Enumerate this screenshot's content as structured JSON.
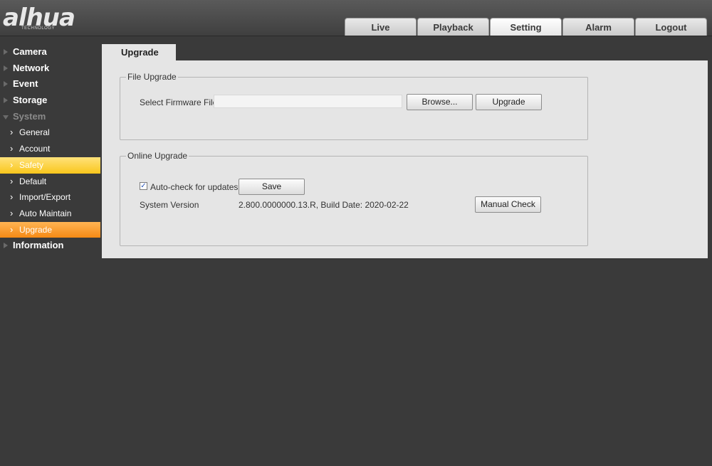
{
  "header": {
    "logo_text": "alhua",
    "logo_subtext": "TECHNOLOGY",
    "tabs": [
      {
        "label": "Live"
      },
      {
        "label": "Playback"
      },
      {
        "label": "Setting",
        "active": true
      },
      {
        "label": "Alarm"
      },
      {
        "label": "Logout"
      }
    ]
  },
  "sidebar": {
    "sections": [
      {
        "label": "Camera",
        "icon": "triangle-right-icon"
      },
      {
        "label": "Network",
        "icon": "triangle-right-icon"
      },
      {
        "label": "Event",
        "icon": "triangle-right-icon"
      },
      {
        "label": "Storage",
        "icon": "triangle-right-icon"
      },
      {
        "label": "System",
        "icon": "triangle-down-icon",
        "expanded": true
      }
    ],
    "system_items": [
      {
        "label": "General"
      },
      {
        "label": "Account"
      },
      {
        "label": "Safety",
        "highlight": "#f9c61c"
      },
      {
        "label": "Default"
      },
      {
        "label": "Import/Export"
      },
      {
        "label": "Auto Maintain"
      },
      {
        "label": "Upgrade",
        "selected": true,
        "highlight": "#f58a15"
      }
    ],
    "information": {
      "label": "Information",
      "icon": "triangle-right-icon"
    }
  },
  "page": {
    "tab_label": "Upgrade",
    "file_upgrade": {
      "legend": "File Upgrade",
      "select_label": "Select Firmware File",
      "file_value": "",
      "browse_label": "Browse...",
      "upgrade_label": "Upgrade"
    },
    "online_upgrade": {
      "legend": "Online Upgrade",
      "autocheck_label": "Auto-check for updates",
      "autocheck_checked": true,
      "save_label": "Save",
      "version_label": "System Version",
      "version_value": "2.800.0000000.13.R, Build Date: 2020-02-22",
      "manual_check_label": "Manual Check"
    }
  },
  "colors": {
    "background": "#3a3a3a",
    "panel": "#e5e5e5",
    "safety_highlight": "#f9c61c",
    "selected_highlight": "#f58a15"
  }
}
